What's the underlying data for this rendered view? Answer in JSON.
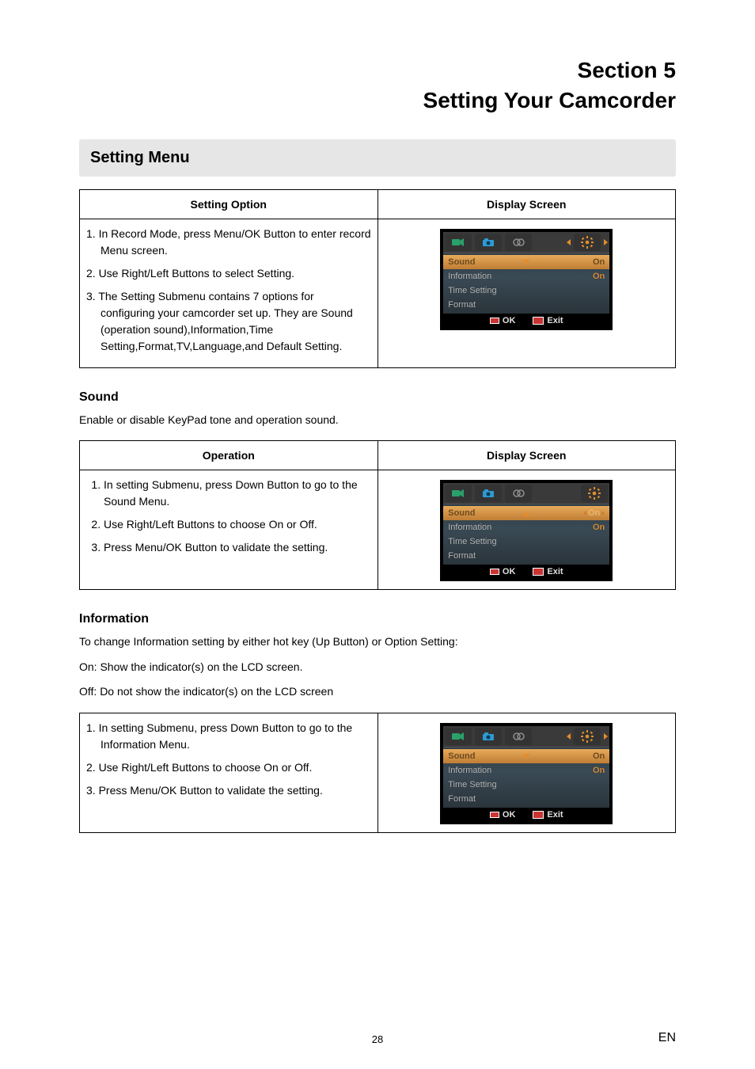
{
  "section": {
    "line1": "Section 5",
    "line2": "Setting Your Camcorder"
  },
  "bar": {
    "setting_menu": "Setting Menu"
  },
  "tables": {
    "t1": {
      "h1": "Setting Option",
      "h2": "Display Screen",
      "s1": "1. In Record Mode, press Menu/OK Button to enter record Menu screen.",
      "s2": "2. Use Right/Left Buttons to select Setting.",
      "s3": "3. The Setting Submenu contains 7 options for configuring your camcorder set up. They are Sound (operation sound),Information,Time Setting,Format,TV,Language,and Default Setting."
    },
    "t2": {
      "h1": "Operation",
      "h2": "Display Screen",
      "s1": "In setting Submenu, press Down Button to go to the Sound Menu.",
      "s2": "Use Right/Left Buttons to choose On or Off.",
      "s3": "Press Menu/OK Button to validate the setting."
    },
    "t3": {
      "s1": "1. In setting Submenu, press Down Button to go to the Information Menu.",
      "s2": "2. Use Right/Left Buttons to choose On or Off.",
      "s3": "3. Press Menu/OK Button to validate the setting."
    }
  },
  "sound": {
    "head": "Sound",
    "lead": "Enable or disable KeyPad tone and operation sound."
  },
  "info": {
    "head": "Information",
    "l1": "To change Information setting by either hot key (Up Button) or Option Setting:",
    "l2": "On: Show the indicator(s) on the LCD screen.",
    "l3": "Off: Do not show the indicator(s) on the LCD screen"
  },
  "lcd": {
    "rows": {
      "sound": "Sound",
      "info": "Information",
      "time": "Time Setting",
      "format": "Format"
    },
    "vals": {
      "on": "On"
    },
    "footer": {
      "ok": "OK",
      "exit": "Exit"
    }
  },
  "page_num": "28",
  "lang": "EN"
}
